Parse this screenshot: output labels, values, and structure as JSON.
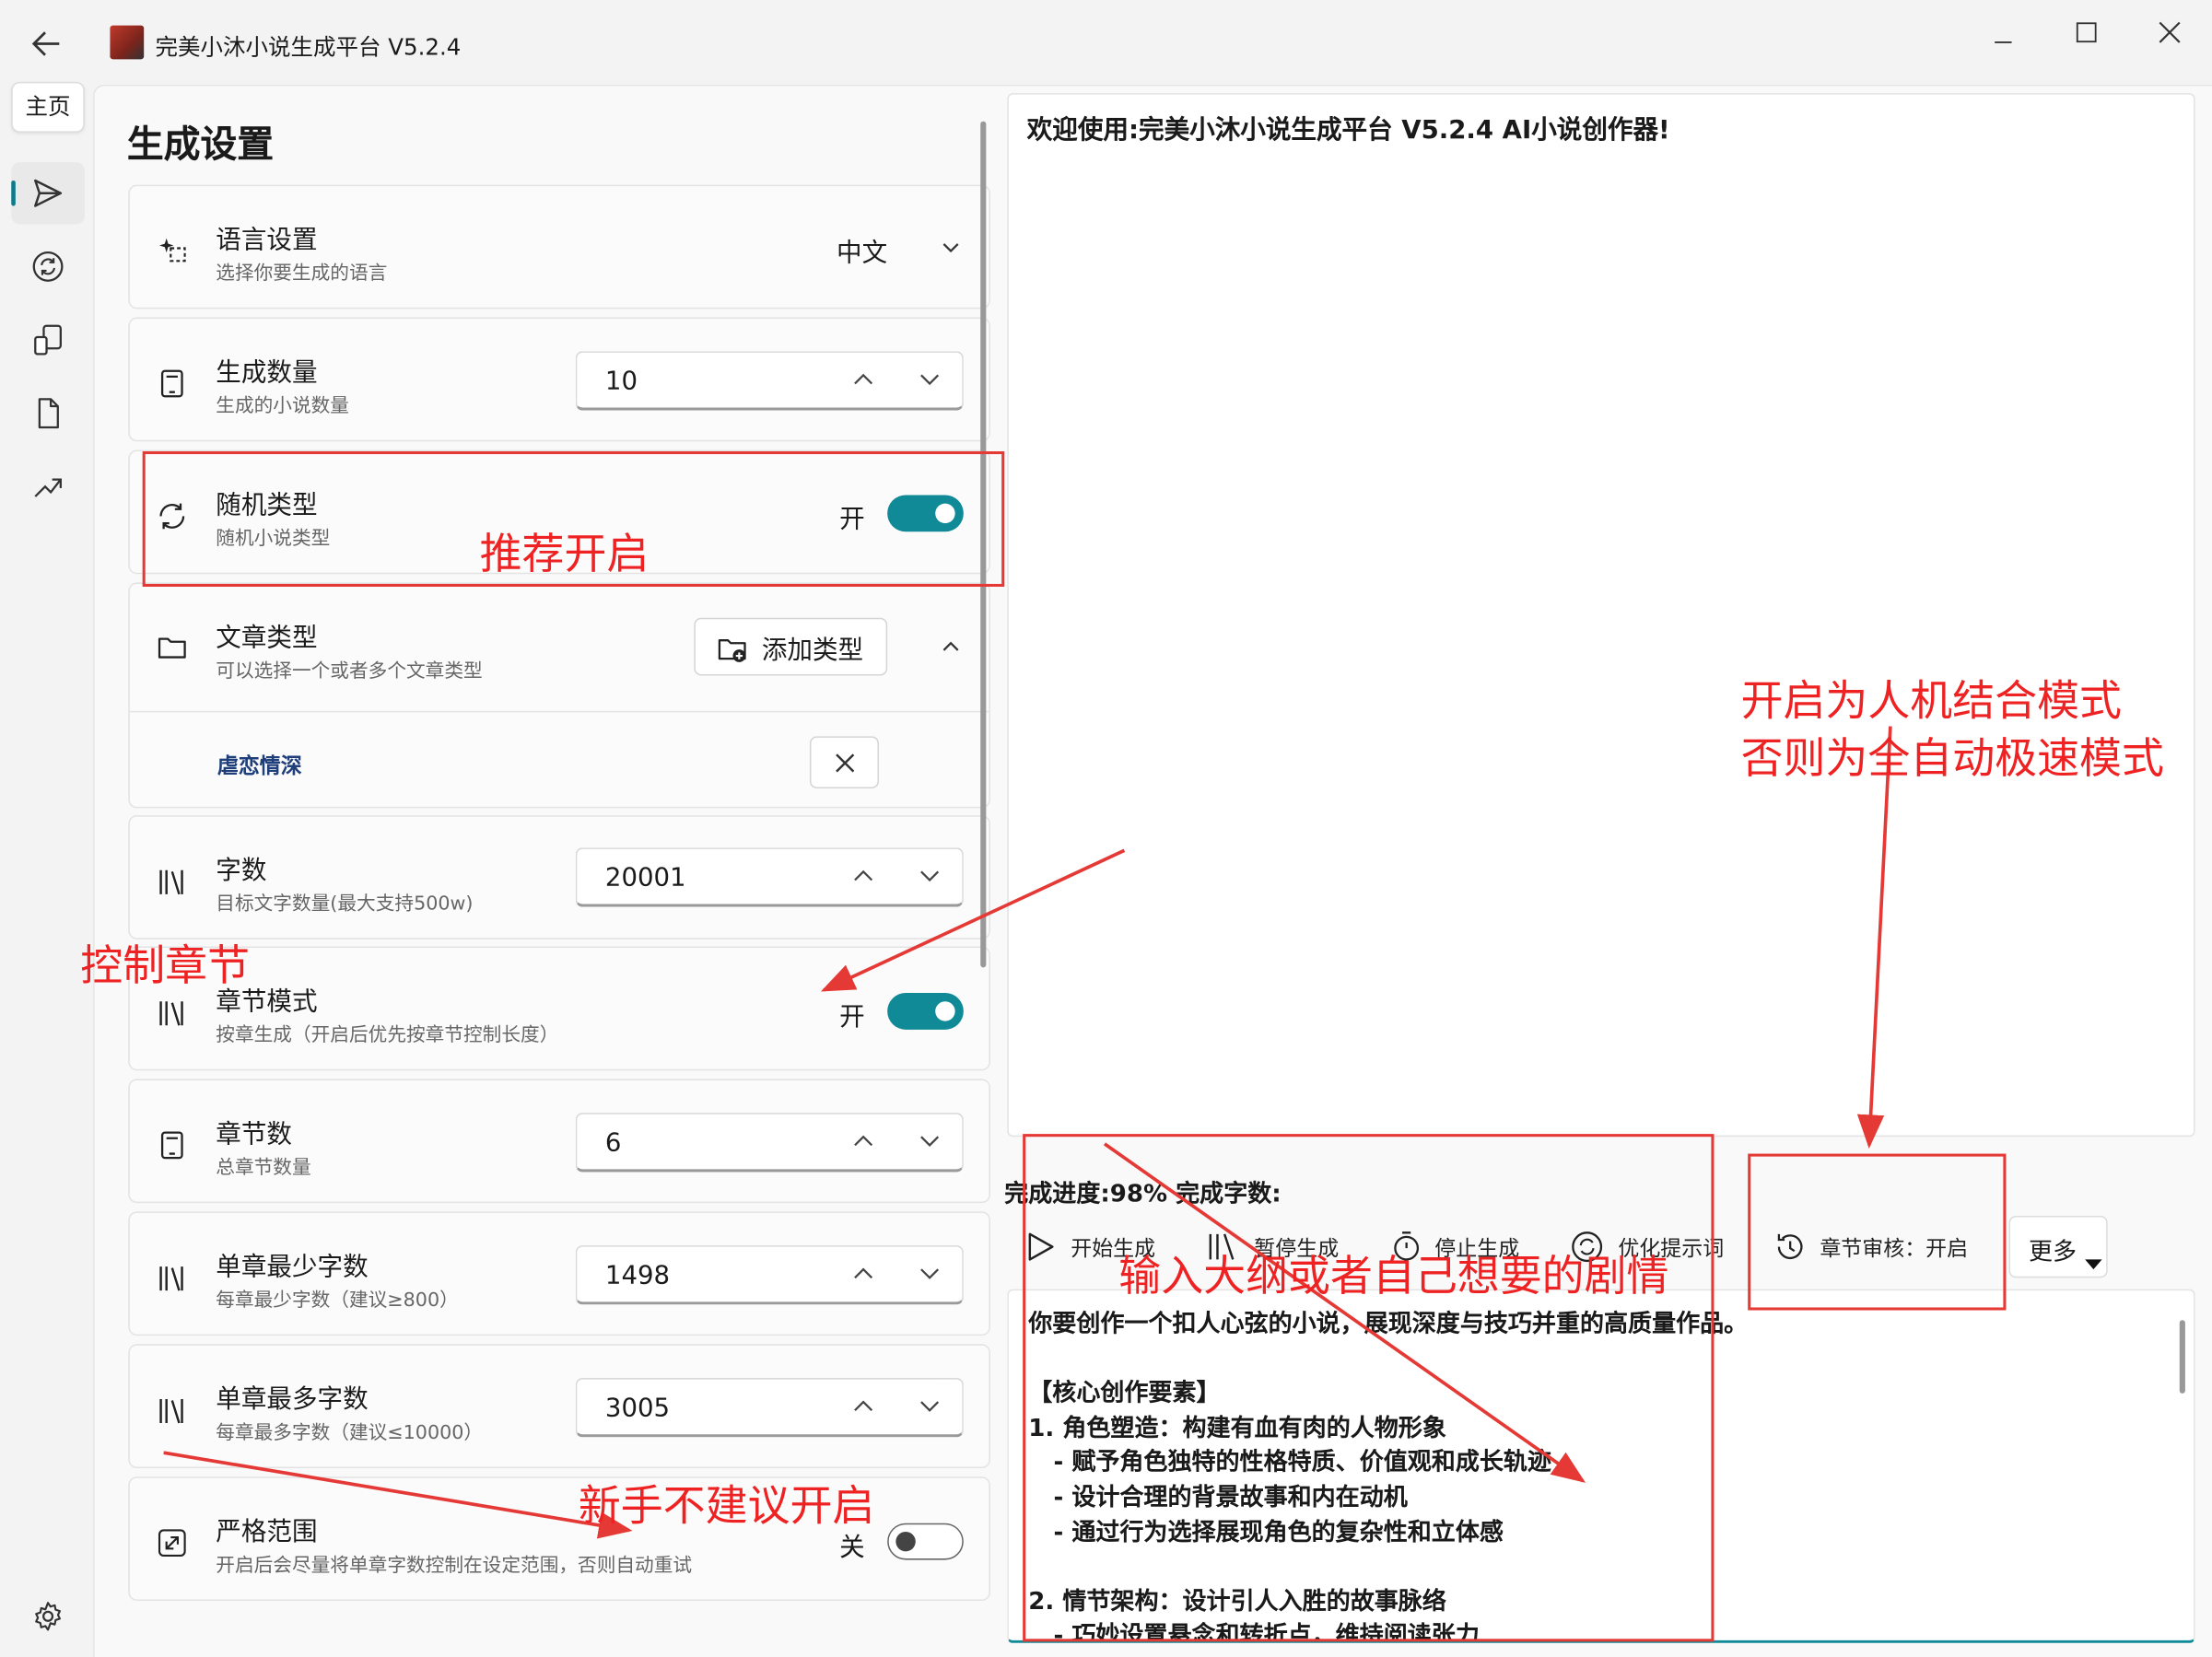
{
  "window": {
    "title": "完美小沐小说生成平台 V5.2.4"
  },
  "nav": {
    "home_label": "主页"
  },
  "settings": {
    "heading": "生成设置",
    "language": {
      "title": "语言设置",
      "subtitle": "选择你要生成的语言",
      "value": "中文"
    },
    "count": {
      "title": "生成数量",
      "subtitle": "生成的小说数量",
      "value": "10"
    },
    "random_type": {
      "title": "随机类型",
      "subtitle": "随机小说类型",
      "state_label": "开",
      "on": true
    },
    "article_type": {
      "title": "文章类型",
      "subtitle": "可以选择一个或者多个文章类型",
      "add_label": "添加类型",
      "tag": "虐恋情深"
    },
    "words": {
      "title": "字数",
      "subtitle": "目标文字数量(最大支持500w)",
      "value": "20001"
    },
    "chapter_mode": {
      "title": "章节模式",
      "subtitle": "按章生成（开启后优先按章节控制长度）",
      "state_label": "开",
      "on": true
    },
    "chapter_count": {
      "title": "章节数",
      "subtitle": "总章节数量",
      "value": "6"
    },
    "min_words": {
      "title": "单章最少字数",
      "subtitle": "每章最少字数（建议≥800）",
      "value": "1498"
    },
    "max_words": {
      "title": "单章最多字数",
      "subtitle": "每章最多字数（建议≤10000）",
      "value": "3005"
    },
    "strict": {
      "title": "严格范围",
      "subtitle": "开启后会尽量将单章字数控制在设定范围，否则自动重试",
      "state_label": "关",
      "on": false
    }
  },
  "output": {
    "welcome": "欢迎使用:完美小沐小说生成平台 V5.2.4 AI小说创作器!"
  },
  "status": {
    "progress": "完成进度:98% 完成字数:"
  },
  "actions": {
    "start": "开始生成",
    "pause": "暂停生成",
    "stop": "停止生成",
    "optimize": "优化提示词",
    "review": "章节审核：开启",
    "more": "更多"
  },
  "prompt_text": "你要创作一个扣人心弦的小说，展现深度与技巧并重的高质量作品。\n\n【核心创作要素】\n1. 角色塑造：构建有血有肉的人物形象\n   - 赋予角色独特的性格特质、价值观和成长轨迹\n   - 设计合理的背景故事和内在动机\n   - 通过行为选择展现角色的复杂性和立体感\n\n2. 情节架构：设计引人入胜的故事脉络\n   - 巧妙设置悬念和转折点，维持阅读张力",
  "annotations": {
    "recommend": "推荐开启",
    "control_chapter": "控制章节",
    "review_line1": "开启为人机结合模式",
    "review_line2": "否则为全自动极速模式",
    "outline": "输入大纲或者自己想要的剧情",
    "newbie": "新手不建议开启"
  },
  "colors": {
    "accent": "#0f8a96",
    "annotation": "#ee2222"
  }
}
